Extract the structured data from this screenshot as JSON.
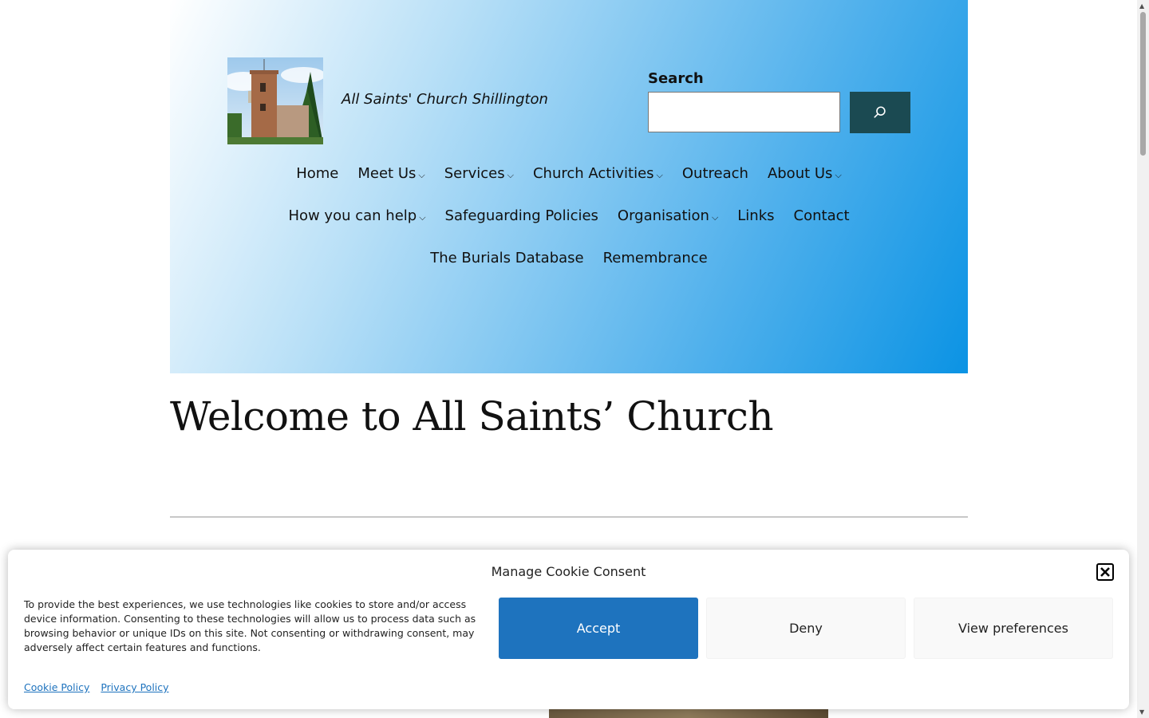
{
  "header": {
    "site_title": "All Saints' Church Shillington",
    "logo_alt": "Church tower",
    "search": {
      "label": "Search",
      "placeholder": "",
      "button_icon": "search-icon"
    },
    "nav_rows": [
      [
        {
          "label": "Home",
          "has_submenu": false
        },
        {
          "label": "Meet Us",
          "has_submenu": true
        },
        {
          "label": "Services",
          "has_submenu": true
        },
        {
          "label": "Church Activities",
          "has_submenu": true
        },
        {
          "label": "Outreach",
          "has_submenu": false
        },
        {
          "label": "About Us",
          "has_submenu": true
        }
      ],
      [
        {
          "label": "How you can help",
          "has_submenu": true
        },
        {
          "label": "Safeguarding Policies",
          "has_submenu": false
        },
        {
          "label": "Organisation",
          "has_submenu": true
        },
        {
          "label": "Links",
          "has_submenu": false
        },
        {
          "label": "Contact",
          "has_submenu": false
        }
      ],
      [
        {
          "label": "The Burials Database",
          "has_submenu": false
        },
        {
          "label": "Remembrance",
          "has_submenu": false
        }
      ]
    ]
  },
  "main": {
    "title": "Welcome to All Saints’ Church"
  },
  "cookie_banner": {
    "title": "Manage Cookie Consent",
    "text": "To provide the best experiences, we use technologies like cookies to store and/or access device information. Consenting to these technologies will allow us to process data such as browsing behavior or unique IDs on this site. Not consenting or withdrawing consent, may adversely affect certain features and functions.",
    "accept_label": "Accept",
    "deny_label": "Deny",
    "preferences_label": "View preferences",
    "links": [
      "Cookie Policy",
      "Privacy Policy"
    ]
  },
  "colors": {
    "header_gradient_end": "#0b93e4",
    "search_button": "#1b4a52",
    "accept_button": "#1e73be",
    "link": "#1e73be"
  }
}
